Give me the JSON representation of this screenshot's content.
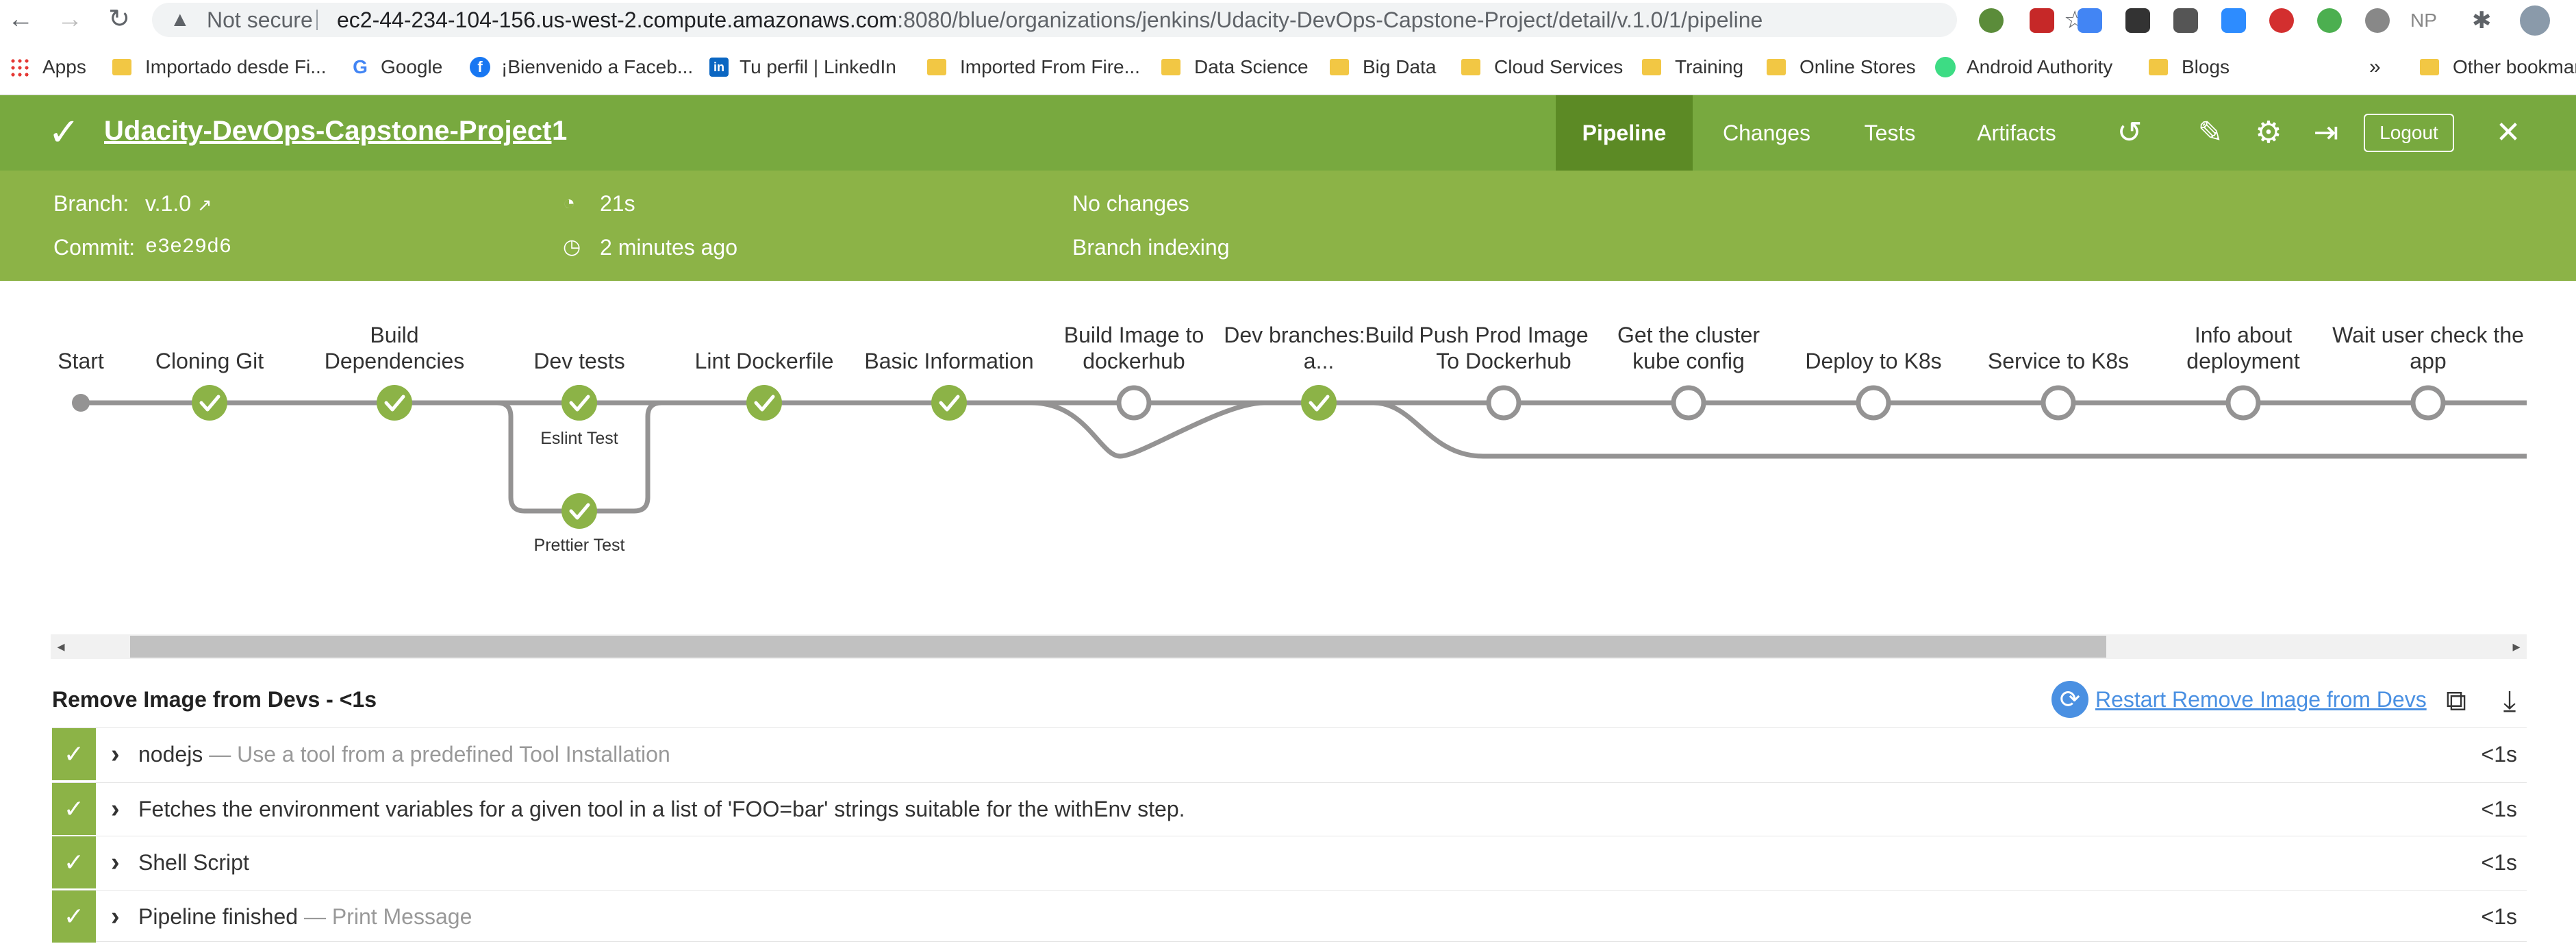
{
  "browser": {
    "not_secure": "Not secure",
    "url_host": "ec2-44-234-104-156.us-west-2.compute.amazonaws.com",
    "url_path": ":8080/blue/organizations/jenkins/Udacity-DevOps-Capstone-Project/detail/v.1.0/1/pipeline",
    "bookmarks": [
      {
        "label": "Apps"
      },
      {
        "label": "Importado desde Fi..."
      },
      {
        "label": "Google"
      },
      {
        "label": "¡Bienvenido a Faceb..."
      },
      {
        "label": "Tu perfil | LinkedIn"
      },
      {
        "label": "Imported From Fire..."
      },
      {
        "label": "Data Science"
      },
      {
        "label": "Big Data"
      },
      {
        "label": "Cloud Services"
      },
      {
        "label": "Training"
      },
      {
        "label": "Online Stores"
      },
      {
        "label": "Android Authority"
      },
      {
        "label": "Blogs"
      },
      {
        "label": "Other bookmar"
      }
    ]
  },
  "header": {
    "project": "Udacity-DevOps-Capstone-Project",
    "run_number": "1",
    "tabs": [
      {
        "label": "Pipeline"
      },
      {
        "label": "Changes"
      },
      {
        "label": "Tests"
      },
      {
        "label": "Artifacts"
      }
    ],
    "logout": "Logout"
  },
  "summary": {
    "branch_label": "Branch:",
    "branch_value": "v.1.0",
    "commit_label": "Commit:",
    "commit_value": "e3e29d6",
    "duration": "21s",
    "time_ago": "2 minutes ago",
    "changes": "No changes",
    "cause": "Branch indexing"
  },
  "pipeline": {
    "stages": [
      {
        "name": "Start",
        "status": "start"
      },
      {
        "name": "Cloning Git",
        "status": "success"
      },
      {
        "name": "Build Dependencies",
        "status": "success"
      },
      {
        "name": "Dev tests",
        "status": "success"
      },
      {
        "name": "Lint Dockerfile",
        "status": "success"
      },
      {
        "name": "Basic Information",
        "status": "success"
      },
      {
        "name": "Build Image to dockerhub",
        "status": "not_built"
      },
      {
        "name": "Dev branches:Build a...",
        "status": "success"
      },
      {
        "name": "Push Prod Image To Dockerhub",
        "status": "not_built"
      },
      {
        "name": "Get the cluster kube config",
        "status": "not_built"
      },
      {
        "name": "Deploy to K8s",
        "status": "not_built"
      },
      {
        "name": "Service to K8s",
        "status": "not_built"
      },
      {
        "name": "Info about deployment",
        "status": "not_built"
      },
      {
        "name": "Wait user check the app",
        "status": "not_built"
      }
    ],
    "parallel": [
      {
        "name": "Eslint Test",
        "status": "success"
      },
      {
        "name": "Prettier Test",
        "status": "success"
      }
    ]
  },
  "steps": {
    "title": "Remove Image from Devs - <1s",
    "restart": "Restart Remove Image from Devs",
    "rows": [
      {
        "name": "nodejs",
        "desc": "— Use a tool from a predefined Tool Installation",
        "duration": "<1s"
      },
      {
        "name": "Fetches the environment variables for a given tool in a list of 'FOO=bar' strings suitable for the withEnv step.",
        "desc": "",
        "duration": "<1s"
      },
      {
        "name": "Shell Script",
        "desc": "",
        "duration": "<1s"
      },
      {
        "name": "Pipeline finished",
        "desc": "— Print Message",
        "duration": "<1s"
      }
    ]
  },
  "colors": {
    "header": "#78a93f",
    "subheader": "#8cb347",
    "success": "#8cb347",
    "link": "#4a90e2"
  }
}
